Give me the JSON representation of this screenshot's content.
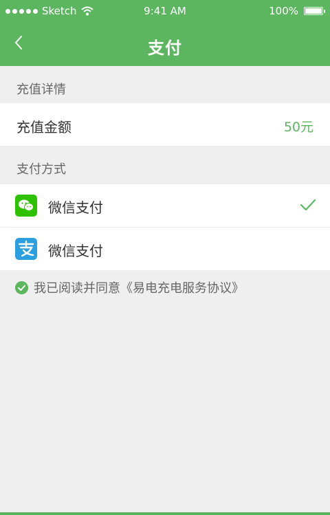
{
  "status_bar": {
    "carrier": "Sketch",
    "time": "9:41 AM",
    "battery": "100%"
  },
  "nav": {
    "title": "支付",
    "back_icon": "chevron-left-icon"
  },
  "recharge": {
    "section_label": "充值详情",
    "amount_label": "充值金额",
    "amount_value": "50元"
  },
  "payment": {
    "section_label": "支付方式",
    "methods": [
      {
        "label": "微信支付",
        "icon": "wechat-icon",
        "selected": true
      },
      {
        "label": "微信支付",
        "icon": "alipay-icon",
        "selected": false
      }
    ]
  },
  "agreement": {
    "text": "我已阅读并同意《易电充电服务协议》",
    "checked": true
  },
  "colors": {
    "accent": "#5cb65f",
    "background": "#efefef",
    "wechat": "#2dc100",
    "alipay": "#2aa0e0"
  }
}
